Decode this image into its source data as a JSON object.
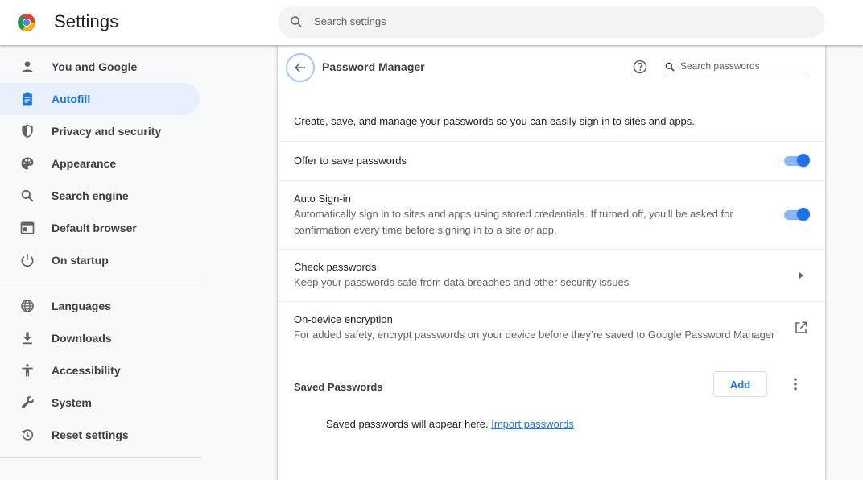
{
  "header": {
    "title": "Settings",
    "search_placeholder": "Search settings"
  },
  "sidebar": {
    "items": [
      {
        "label": "You and Google",
        "icon": "person-icon"
      },
      {
        "label": "Autofill",
        "icon": "clipboard-icon",
        "active": true
      },
      {
        "label": "Privacy and security",
        "icon": "shield-icon"
      },
      {
        "label": "Appearance",
        "icon": "palette-icon"
      },
      {
        "label": "Search engine",
        "icon": "search-icon"
      },
      {
        "label": "Default browser",
        "icon": "browser-window-icon"
      },
      {
        "label": "On startup",
        "icon": "power-icon"
      },
      {
        "label": "Languages",
        "icon": "globe-icon"
      },
      {
        "label": "Downloads",
        "icon": "download-icon"
      },
      {
        "label": "Accessibility",
        "icon": "accessibility-icon"
      },
      {
        "label": "System",
        "icon": "wrench-icon"
      },
      {
        "label": "Reset settings",
        "icon": "history-icon"
      }
    ]
  },
  "main": {
    "title": "Password Manager",
    "search_placeholder": "Search passwords",
    "description": "Create, save, and manage your passwords so you can easily sign in to sites and apps.",
    "offer_save": {
      "label": "Offer to save passwords",
      "enabled": true
    },
    "auto_signin": {
      "label": "Auto Sign-in",
      "desc_line1": "Automatically sign in to sites and apps using stored credentials. If turned off, you'll be asked for",
      "desc_line2": "confirmation every time before signing in to a site or app.",
      "enabled": true
    },
    "check_passwords": {
      "label": "Check passwords",
      "desc": "Keep your passwords safe from data breaches and other security issues"
    },
    "encryption": {
      "label": "On-device encryption",
      "desc": "For added safety, encrypt passwords on your device before they’re saved to Google Password Manager"
    },
    "saved": {
      "heading": "Saved Passwords",
      "add_label": "Add",
      "empty_text": "Saved passwords will appear here.",
      "import_link": "Import passwords"
    }
  },
  "colors": {
    "accent": "#1a73e8",
    "active_nav_bg": "#e8f0fe",
    "toggle_track": "#8ab4f8"
  }
}
